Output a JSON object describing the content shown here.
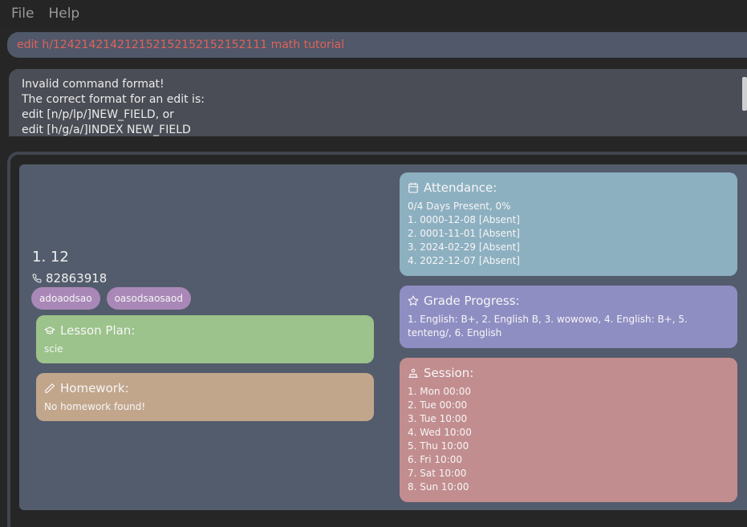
{
  "menu": {
    "file": "File",
    "help": "Help"
  },
  "command": {
    "value": "edit h/124214214212152152152152152111 math tutorial"
  },
  "result": {
    "lines": [
      "Invalid command format!",
      "The correct format for an edit is:",
      "edit [n/p/lp/]NEW_FIELD, or",
      "edit [h/g/a/]INDEX NEW_FIELD"
    ]
  },
  "person": {
    "index_name": "1.  12",
    "phone": "82863918",
    "tags": [
      "adoaodsao",
      "oasodsaosaod"
    ]
  },
  "lesson_plan": {
    "title": "Lesson Plan:",
    "body": "scie"
  },
  "homework": {
    "title": "Homework:",
    "body": "No homework found!"
  },
  "attendance": {
    "title": "Attendance:",
    "summary": "0/4 Days Present, 0%",
    "items": [
      "1. 0000-12-08 [Absent]",
      "2. 0001-11-01 [Absent]",
      "3. 2024-02-29 [Absent]",
      "4. 2022-12-07 [Absent]"
    ]
  },
  "grade_progress": {
    "title": "Grade Progress:",
    "body": "1. English: B+, 2. English B, 3. wowowo, 4. English: B+, 5. tenteng/, 6. English"
  },
  "session": {
    "title": "Session:",
    "items": [
      "1. Mon 00:00",
      "2. Tue 00:00",
      "3. Tue 10:00",
      "4. Wed 10:00",
      "5. Thu 10:00",
      "6. Fri 10:00",
      "7. Sat 10:00",
      "8. Sun 10:00"
    ]
  },
  "colors": {
    "background": "#262626",
    "command_text": "#e0625a",
    "lesson_card": "#9cc38b",
    "homework_card": "#c2a68c",
    "attendance_card": "#8db0c1",
    "grade_card": "#8f8ec3",
    "session_card": "#c28d8f",
    "tag": "#a988b8"
  }
}
